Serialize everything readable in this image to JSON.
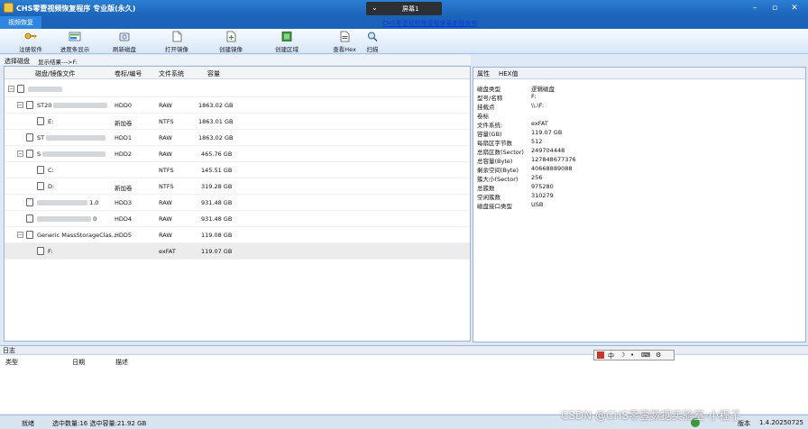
{
  "titlebar": {
    "title": "CHS零壹视频恢复程序 专业版(永久)",
    "screen_tab": "屏幕1",
    "announcement_link": "CHS零壹视频恢复程序最新版发布",
    "window_icons": [
      "minimize-icon",
      "restore-icon",
      "close-icon"
    ]
  },
  "ribbon": {
    "active_tab": "视频恢复",
    "tools": [
      {
        "label": "注册软件",
        "icon": "key-icon"
      },
      {
        "label": "进度条显示",
        "icon": "progress-icon"
      },
      {
        "label": "刷新磁盘",
        "icon": "refresh-disk-icon"
      },
      {
        "label": "打开镜像",
        "icon": "open-image-icon"
      },
      {
        "label": "创建镜像",
        "icon": "create-image-icon"
      },
      {
        "label": "创建区域",
        "icon": "create-region-icon"
      },
      {
        "label": "查看Hex",
        "icon": "hex-icon"
      },
      {
        "label": "扫描",
        "icon": "scan-icon"
      }
    ]
  },
  "subheader": {
    "select_disk": "选择磁盘",
    "display_result": "显示结果--->F:"
  },
  "disk_table": {
    "columns": [
      "磁盘/镜像文件",
      "卷标/编号",
      "文件系统",
      "容量"
    ],
    "rows": [
      {
        "level": 0,
        "name": "",
        "label": "",
        "fs": "",
        "cap": "",
        "expander": "−"
      },
      {
        "level": 1,
        "name": "ST20",
        "label": "HDD0",
        "fs": "RAW",
        "cap": "1863.02 GB",
        "expander": "−"
      },
      {
        "level": 2,
        "name": "E:",
        "label": "新加卷",
        "fs": "NTFS",
        "cap": "1863.01 GB",
        "expander": ""
      },
      {
        "level": 1,
        "name": "ST",
        "label": "HDD1",
        "fs": "RAW",
        "cap": "1863.02 GB",
        "expander": ""
      },
      {
        "level": 1,
        "name": "S",
        "label": "HDD2",
        "fs": "RAW",
        "cap": "465.76 GB",
        "expander": "−"
      },
      {
        "level": 2,
        "name": "C:",
        "label": "",
        "fs": "NTFS",
        "cap": "145.51 GB",
        "expander": ""
      },
      {
        "level": 2,
        "name": "D:",
        "label": "新加卷",
        "fs": "NTFS",
        "cap": "319.28 GB",
        "expander": ""
      },
      {
        "level": 1,
        "name": "1.0",
        "label": "HDD3",
        "fs": "RAW",
        "cap": "931.48 GB",
        "expander": ""
      },
      {
        "level": 1,
        "name": "0",
        "label": "HDD4",
        "fs": "RAW",
        "cap": "931.48 GB",
        "expander": ""
      },
      {
        "level": 1,
        "name": "Generic MassStorageClas...",
        "label": "HDD5",
        "fs": "RAW",
        "cap": "119.08 GB",
        "expander": "−"
      },
      {
        "level": 2,
        "name": "F:",
        "label": "",
        "fs": "exFAT",
        "cap": "119.07 GB",
        "expander": ""
      }
    ]
  },
  "properties": {
    "tabs": [
      "属性",
      "HEX值"
    ],
    "items": [
      {
        "k": "磁盘类型",
        "v": "逻辑磁盘"
      },
      {
        "k": "型号/名称",
        "v": "F:"
      },
      {
        "k": "挂载点",
        "v": "\\\\.\\F:"
      },
      {
        "k": "卷标",
        "v": ""
      },
      {
        "k": "文件系统:",
        "v": "exFAT"
      },
      {
        "k": "容量(GB)",
        "v": "119.07 GB"
      },
      {
        "k": "每扇区字节数",
        "v": "512"
      },
      {
        "k": "总扇区数(Sector)",
        "v": "249704448"
      },
      {
        "k": "总容量(Byte)",
        "v": "127848677376"
      },
      {
        "k": "剩余空间(Byte)",
        "v": "40668889088"
      },
      {
        "k": "簇大小(Sector)",
        "v": "256"
      },
      {
        "k": "总簇数",
        "v": "975280"
      },
      {
        "k": "空闲簇数",
        "v": "310279"
      },
      {
        "k": "磁盘接口类型",
        "v": "USB"
      }
    ]
  },
  "log": {
    "title": "日志",
    "columns": [
      "类型",
      "日期",
      "描述"
    ]
  },
  "ime_toolbar": [
    "中",
    "☽",
    "•",
    "⌨",
    "⚙"
  ],
  "statusbar": {
    "ready": "就绪",
    "selection": "选中数量:16 选中容量:21.92 GB",
    "ver_label": "版本",
    "version": "1.4.20250725"
  },
  "watermark": "CSDN @CHS零壹数据实验室-小程子",
  "colors": {
    "accent": "#1b63b8",
    "selected_row": "#ececec"
  }
}
